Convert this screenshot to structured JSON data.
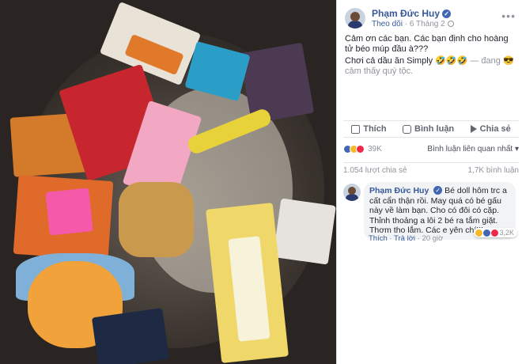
{
  "post": {
    "author": "Phạm Đức Huy",
    "follow_label": "Theo dõi",
    "separator": " · ",
    "date": "6 Tháng 2",
    "menu_icon": "more-dots-icon",
    "text_line1": "Cảm ơn các bạn. Các bạn định cho hoàng tử béo múp đầu à???",
    "text_line2_main": "Chơi cả dầu ăn Simply 🤣🤣🤣",
    "text_line2_feeling": " — đang 😎 cảm thấy quý tộc."
  },
  "actions": {
    "like": "Thích",
    "comment": "Bình luận",
    "share": "Chia sẻ"
  },
  "reactions": {
    "count": "39K",
    "sort_label": "Bình luận liên quan nhất ▾",
    "shares": "1.054 lượt chia sẻ",
    "comments_count": "1,7K bình luận"
  },
  "comment": {
    "author": "Phạm Đức Huy",
    "text": "Bé doll hôm trc a cất cẩn thận rồi. May quá có bé gấu này về làm bạn. Cho có đôi có cặp. Thỉnh thoảng a lôi 2 bé ra tắm giặt. Thơm tho lắm. Các e yên chí!!!",
    "like_label": "Thích",
    "reply_label": "Trả lời",
    "time": "20 giờ",
    "reaction_count": "3,2K"
  },
  "colors": {
    "link_blue": "#365899",
    "like_blue": "#4267b2",
    "haha_yellow": "#f7b928",
    "love_red": "#f0284a"
  }
}
